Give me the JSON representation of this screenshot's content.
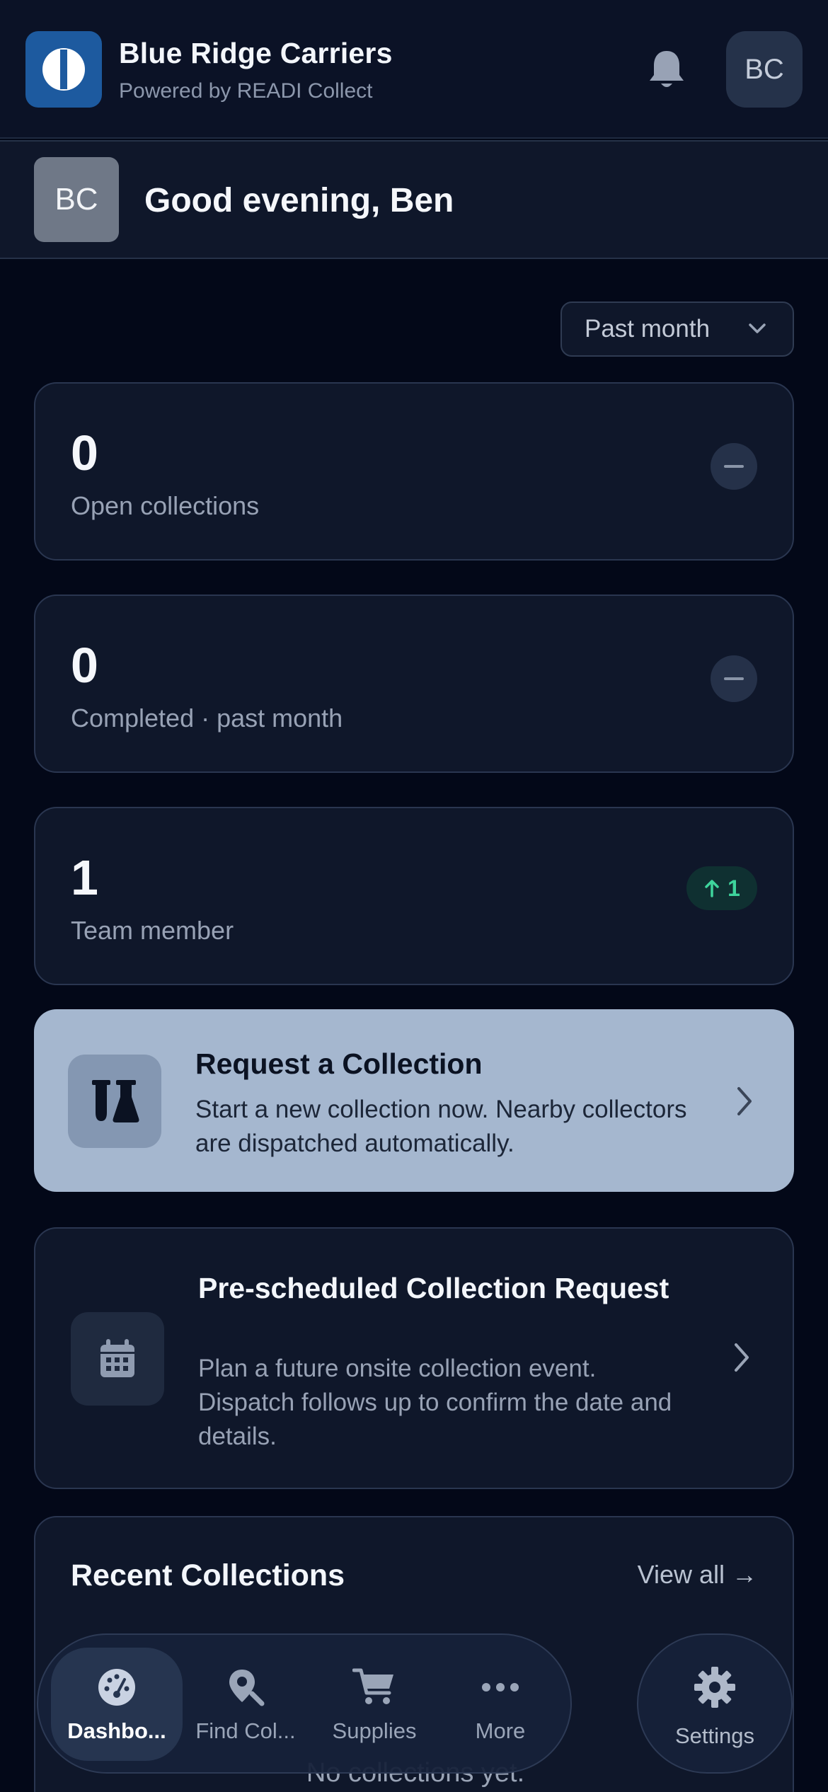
{
  "header": {
    "org_name": "Blue Ridge Carriers",
    "org_subtitle": "Powered by READI Collect",
    "avatar_initials": "BC"
  },
  "greeting": {
    "avatar_initials": "BC",
    "text": "Good evening, Ben"
  },
  "period_filter": {
    "selected": "Past month"
  },
  "stats": [
    {
      "value": "0",
      "label": "Open collections",
      "trend": "neutral"
    },
    {
      "value": "0",
      "label": "Completed · past month",
      "trend": "neutral"
    },
    {
      "value": "1",
      "label": "Team member",
      "trend": "up",
      "trend_value": "1"
    }
  ],
  "request_card": {
    "title": "Request a Collection",
    "description": "Start a new collection now. Nearby collectors are dispatched automatically."
  },
  "prescheduled_card": {
    "title": "Pre-scheduled Collection Request",
    "description": "Plan a future onsite collection event. Dispatch follows up to confirm the date and details."
  },
  "recent": {
    "title": "Recent Collections",
    "view_all": "View all →",
    "empty_text": "No collections yet."
  },
  "nav": {
    "items": [
      {
        "label": "Dashbo...",
        "icon": "dashboard-gauge-icon",
        "active": true
      },
      {
        "label": "Find Col...",
        "icon": "map-pin-search-icon",
        "active": false
      },
      {
        "label": "Supplies",
        "icon": "cart-icon",
        "active": false
      },
      {
        "label": "More",
        "icon": "more-dots-icon",
        "active": false
      }
    ],
    "settings_label": "Settings"
  },
  "colors": {
    "background": "#030818",
    "card": "#0f172a",
    "accent_card": "#a5b7cf",
    "trend_up": "#3ed49c",
    "brand_logo": "#1d5a9f"
  }
}
